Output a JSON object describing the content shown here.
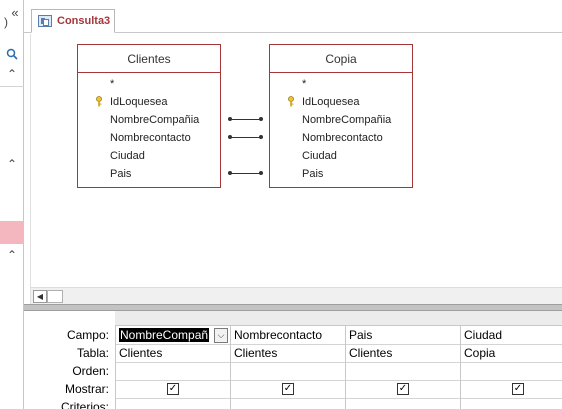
{
  "nav": {
    "icons": [
      "expand-right-icon",
      "collapse-left-icon",
      "search-icon",
      "collapse-up-icon",
      "collapse-up-icon",
      "collapse-up-icon"
    ]
  },
  "tab": {
    "label": "Consulta3"
  },
  "tables": [
    {
      "title": "Clientes",
      "fields": [
        "*",
        "IdLoquesea",
        "NombreCompañia",
        "Nombrecontacto",
        "Ciudad",
        "Pais"
      ],
      "key_field_index": 1
    },
    {
      "title": "Copia",
      "fields": [
        "*",
        "IdLoquesea",
        "NombreCompañia",
        "Nombrecontacto",
        "Ciudad",
        "Pais"
      ],
      "key_field_index": 1
    }
  ],
  "grid": {
    "row_labels": [
      "Campo:",
      "Tabla:",
      "Orden:",
      "Mostrar:",
      "Criterios:"
    ],
    "columns": [
      {
        "campo": "NombreCompañ",
        "tabla": "Clientes",
        "mostrar": true
      },
      {
        "campo": "Nombrecontacto",
        "tabla": "Clientes",
        "mostrar": true
      },
      {
        "campo": "Pais",
        "tabla": "Clientes",
        "mostrar": true
      },
      {
        "campo": "Ciudad",
        "tabla": "Copia",
        "mostrar": true
      }
    ]
  },
  "colors": {
    "accent": "#a4373a",
    "nav_selected": "#f4b6bf"
  }
}
